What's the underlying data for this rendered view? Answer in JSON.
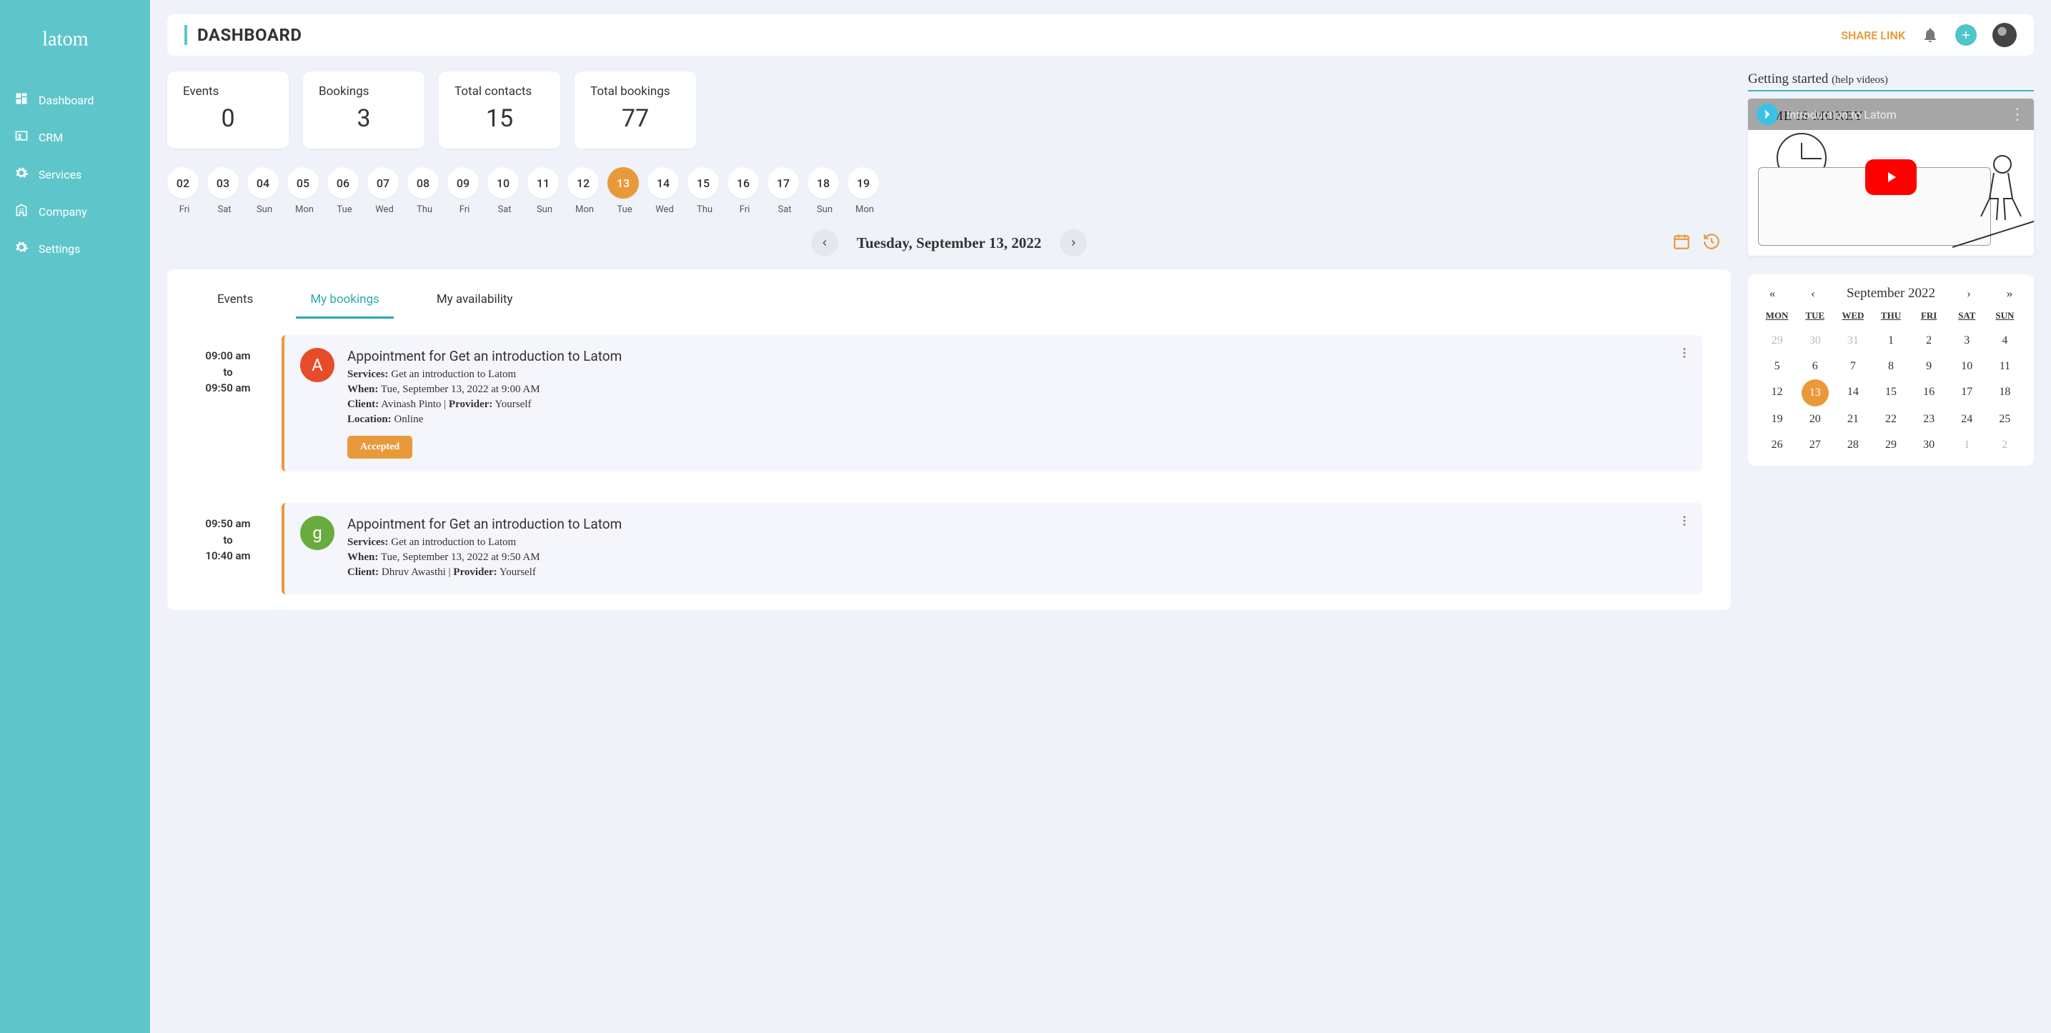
{
  "sidebar": {
    "logo_text": "latom",
    "items": [
      {
        "label": "Dashboard",
        "icon": "dashboard"
      },
      {
        "label": "CRM",
        "icon": "account"
      },
      {
        "label": "Services",
        "icon": "gear"
      },
      {
        "label": "Company",
        "icon": "building"
      },
      {
        "label": "Settings",
        "icon": "gear"
      }
    ]
  },
  "topbar": {
    "title": "DASHBOARD",
    "share_link_label": "SHARE LINK"
  },
  "stats": [
    {
      "label": "Events",
      "value": "0"
    },
    {
      "label": "Bookings",
      "value": "3"
    },
    {
      "label": "Total contacts",
      "value": "15"
    },
    {
      "label": "Total bookings",
      "value": "77"
    }
  ],
  "date_strip": [
    {
      "num": "02",
      "dow": "Fri"
    },
    {
      "num": "03",
      "dow": "Sat"
    },
    {
      "num": "04",
      "dow": "Sun"
    },
    {
      "num": "05",
      "dow": "Mon"
    },
    {
      "num": "06",
      "dow": "Tue"
    },
    {
      "num": "07",
      "dow": "Wed"
    },
    {
      "num": "08",
      "dow": "Thu"
    },
    {
      "num": "09",
      "dow": "Fri"
    },
    {
      "num": "10",
      "dow": "Sat"
    },
    {
      "num": "11",
      "dow": "Sun"
    },
    {
      "num": "12",
      "dow": "Mon"
    },
    {
      "num": "13",
      "dow": "Tue",
      "selected": true
    },
    {
      "num": "14",
      "dow": "Wed"
    },
    {
      "num": "15",
      "dow": "Thu"
    },
    {
      "num": "16",
      "dow": "Fri"
    },
    {
      "num": "17",
      "dow": "Sat"
    },
    {
      "num": "18",
      "dow": "Sun"
    },
    {
      "num": "19",
      "dow": "Mon"
    }
  ],
  "current_date": "Tuesday, September 13, 2022",
  "tabs": [
    {
      "label": "Events"
    },
    {
      "label": "My bookings",
      "active": true
    },
    {
      "label": "My availability"
    }
  ],
  "bookings": [
    {
      "start": "09:00 am",
      "to_label": "to",
      "end": "09:50 am",
      "avatar_letter": "A",
      "avatar_color": "#e74c2a",
      "title": "Appointment for Get an introduction to Latom",
      "services_label": "Services:",
      "services": "Get an introduction to Latom",
      "when_label": "When:",
      "when": "Tue, September 13, 2022 at 9:00 AM",
      "client_label": "Client:",
      "client": "Avinash Pinto",
      "divider": " | ",
      "provider_label": "Provider:",
      "provider": "Yourself",
      "location_label": "Location:",
      "location": "Online",
      "status": "Accepted"
    },
    {
      "start": "09:50 am",
      "to_label": "to",
      "end": "10:40 am",
      "avatar_letter": "g",
      "avatar_color": "#6aab3e",
      "title": "Appointment for Get an introduction to Latom",
      "services_label": "Services:",
      "services": "Get an introduction to Latom",
      "when_label": "When:",
      "when": "Tue, September 13, 2022 at 9:50 AM",
      "client_label": "Client:",
      "client": "Dhruv Awasthi",
      "divider": " | ",
      "provider_label": "Provider:",
      "provider": "Yourself"
    }
  ],
  "getting_started": {
    "title": "Getting started ",
    "subtitle": "(help videos)",
    "video_title": "Introduction to Latom",
    "video_bg_text": "TIME IS MONEY"
  },
  "mini_calendar": {
    "title": "September 2022",
    "nav": {
      "first": "«",
      "prev": "‹",
      "next": "›",
      "last": "»"
    },
    "dow": [
      "MON",
      "TUE",
      "WED",
      "THU",
      "FRI",
      "SAT",
      "SUN"
    ],
    "days": [
      {
        "n": "29",
        "muted": true
      },
      {
        "n": "30",
        "muted": true
      },
      {
        "n": "31",
        "muted": true
      },
      {
        "n": "1"
      },
      {
        "n": "2"
      },
      {
        "n": "3"
      },
      {
        "n": "4"
      },
      {
        "n": "5"
      },
      {
        "n": "6"
      },
      {
        "n": "7"
      },
      {
        "n": "8"
      },
      {
        "n": "9"
      },
      {
        "n": "10"
      },
      {
        "n": "11"
      },
      {
        "n": "12"
      },
      {
        "n": "13",
        "selected": true
      },
      {
        "n": "14"
      },
      {
        "n": "15"
      },
      {
        "n": "16"
      },
      {
        "n": "17"
      },
      {
        "n": "18"
      },
      {
        "n": "19"
      },
      {
        "n": "20"
      },
      {
        "n": "21"
      },
      {
        "n": "22"
      },
      {
        "n": "23"
      },
      {
        "n": "24"
      },
      {
        "n": "25"
      },
      {
        "n": "26"
      },
      {
        "n": "27"
      },
      {
        "n": "28"
      },
      {
        "n": "29"
      },
      {
        "n": "30"
      },
      {
        "n": "1",
        "muted": true
      },
      {
        "n": "2",
        "muted": true
      }
    ]
  }
}
